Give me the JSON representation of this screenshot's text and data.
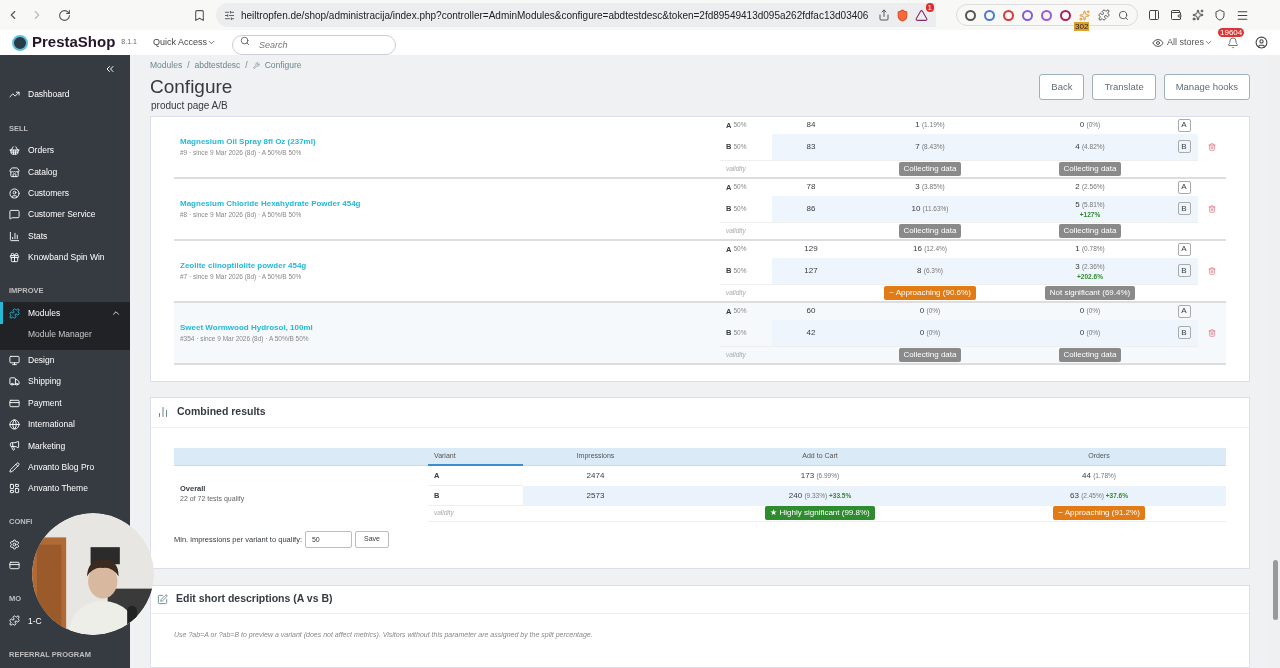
{
  "browser": {
    "url": "heiltropfen.de/shop/administracija/index.php?controller=AdminModules&configure=abdtestdesc&token=2fd89549413d095a262fdfac13d03406",
    "alert_badge": "1",
    "extension_badge": "302"
  },
  "header": {
    "logo": "PrestaShop",
    "version": "8.1.1",
    "quick_access": "Quick Access",
    "search_placeholder": "Search",
    "stores": "All stores",
    "notifications": "19604"
  },
  "sidebar": {
    "top": [
      {
        "label": "Dashboard",
        "selected": false
      }
    ],
    "sections": [
      {
        "title": "SELL",
        "items": [
          {
            "label": "Orders",
            "selected": false
          },
          {
            "label": "Catalog",
            "selected": false
          },
          {
            "label": "Customers",
            "selected": false
          },
          {
            "label": "Customer Service",
            "selected": false
          },
          {
            "label": "Stats",
            "selected": false
          },
          {
            "label": "Knowband Spin Win",
            "selected": false
          }
        ]
      },
      {
        "title": "IMPROVE",
        "items": [
          {
            "label": "Modules",
            "selected": true,
            "expanded": true,
            "children": [
              {
                "label": "Module Manager"
              }
            ]
          },
          {
            "label": "Design",
            "selected": false
          },
          {
            "label": "Shipping",
            "selected": false
          },
          {
            "label": "Payment",
            "selected": false
          },
          {
            "label": "International",
            "selected": false
          },
          {
            "label": "Marketing",
            "selected": false
          },
          {
            "label": "Anvanto Blog Pro",
            "selected": false
          },
          {
            "label": "Anvanto Theme",
            "selected": false
          }
        ]
      },
      {
        "title": "CONFI"
      },
      {
        "title": "MO",
        "items": [
          {
            "label": "1-C",
            "selected": false
          }
        ]
      },
      {
        "title": "REFERRAL PROGRAM"
      }
    ]
  },
  "breadcrumb": {
    "separator": "/",
    "items": [
      "Modules",
      "abdtestdesc",
      "Configure"
    ]
  },
  "page": {
    "title": "Configure",
    "subtitle": "product page A/B",
    "buttons": [
      "Back",
      "Translate",
      "Manage hooks"
    ]
  },
  "tests": [
    {
      "name": "Magnesium Oil Spray 8fl Oz (237ml)",
      "meta": "#9 · since 9 Mar 2026 (8d) · A 50%/B 50%",
      "variants": [
        {
          "label": "A",
          "split": "50%",
          "impressions": "84",
          "cart": "1",
          "cart_pct": "(1.19%)",
          "orders": "0",
          "orders_pct": "(0%)",
          "tag": "A"
        },
        {
          "label": "B",
          "split": "50%",
          "impressions": "83",
          "cart": "7",
          "cart_pct": "(8.43%)",
          "orders": "4",
          "orders_pct": "(4.82%)",
          "tag": "B"
        }
      ],
      "validity": "validity",
      "cart_status": {
        "text": "Collecting data",
        "kind": "neutral"
      },
      "orders_status": {
        "text": "Collecting data",
        "kind": "neutral"
      }
    },
    {
      "name": "Magnesium Chloride Hexahydrate Powder 454g",
      "meta": "#8 · since 9 Mar 2026 (8d) · A 50%/B 50%",
      "variants": [
        {
          "label": "A",
          "split": "50%",
          "impressions": "78",
          "cart": "3",
          "cart_pct": "(3.85%)",
          "orders": "2",
          "orders_pct": "(2.56%)",
          "tag": "A"
        },
        {
          "label": "B",
          "split": "50%",
          "impressions": "86",
          "cart": "10",
          "cart_pct": "(11.63%)",
          "orders": "5",
          "orders_pct": "(5.81%)",
          "orders_lift": "+127%",
          "tag": "B"
        }
      ],
      "validity": "validity",
      "cart_status": {
        "text": "Collecting data",
        "kind": "neutral"
      },
      "orders_status": {
        "text": "Collecting data",
        "kind": "neutral"
      }
    },
    {
      "name": "Zeolite clinoptilolite powder 454g",
      "meta": "#7 · since 9 Mar 2026 (8d) · A 50%/B 50%",
      "variants": [
        {
          "label": "A",
          "split": "50%",
          "impressions": "129",
          "cart": "16",
          "cart_pct": "(12.4%)",
          "orders": "1",
          "orders_pct": "(0.78%)",
          "tag": "A"
        },
        {
          "label": "B",
          "split": "50%",
          "impressions": "127",
          "cart": "8",
          "cart_pct": "(6.3%)",
          "orders": "3",
          "orders_pct": "(2.36%)",
          "orders_lift": "+202.6%",
          "tag": "B"
        }
      ],
      "validity": "validity",
      "cart_status": {
        "text": "~ Approaching (90.6%)",
        "kind": "warning"
      },
      "orders_status": {
        "text": "Not significant (69.4%)",
        "kind": "neutral"
      }
    },
    {
      "name": "Sweet Wormwood Hydrosol, 100ml",
      "meta": "#354 · since 9 Mar 2026 (8d) · A 50%/B 50%",
      "variants": [
        {
          "label": "A",
          "split": "50%",
          "impressions": "60",
          "cart": "0",
          "cart_pct": "(0%)",
          "orders": "0",
          "orders_pct": "(0%)",
          "tag": "A"
        },
        {
          "label": "B",
          "split": "50%",
          "impressions": "42",
          "cart": "0",
          "cart_pct": "(0%)",
          "orders": "0",
          "orders_pct": "(0%)",
          "tag": "B"
        }
      ],
      "validity": "validity",
      "cart_status": {
        "text": "Collecting data",
        "kind": "neutral"
      },
      "orders_status": {
        "text": "Collecting data",
        "kind": "neutral"
      }
    }
  ],
  "combined": {
    "title": "Combined results",
    "columns": [
      "Variant",
      "Impressions",
      "Add to Cart",
      "Orders"
    ],
    "overall": "Overall",
    "qualify": "22 of 72 tests qualify",
    "rows": [
      {
        "variant": "A",
        "impressions": "2474",
        "cart": "173",
        "cart_pct": "(6.99%)",
        "orders": "44",
        "orders_pct": "(1.78%)"
      },
      {
        "variant": "B",
        "impressions": "2573",
        "cart": "240",
        "cart_pct": "(9.33%)",
        "cart_lift": "+33.5%",
        "orders": "63",
        "orders_pct": "(2.45%)",
        "orders_lift": "+37.6%"
      }
    ],
    "validity": "validity",
    "cart_status": {
      "text": "★ Highly significant (99.8%)",
      "kind": "success"
    },
    "orders_status": {
      "text": "~ Approaching (91.2%)",
      "kind": "warning"
    },
    "min_label": "Min. impressions per variant to qualify:",
    "min_value": "50",
    "save": "Save"
  },
  "edit": {
    "title": "Edit short descriptions (A vs B)",
    "hint": "Use ?ab=A or ?ab=B to preview a variant (does not affect metrics). Visitors without this parameter are assigned by the split percentage."
  }
}
